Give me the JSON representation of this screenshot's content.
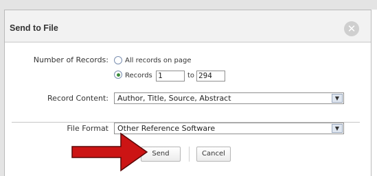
{
  "dialog": {
    "title": "Send to File",
    "close_icon": "close-icon",
    "number_of_records": {
      "label": "Number of Records:",
      "option_all": "All records on page",
      "option_range": "Records",
      "range_from": "1",
      "range_to_label": "to",
      "range_to": "294",
      "selected": "Records"
    },
    "record_content": {
      "label": "Record Content:",
      "value": "Author, Title, Source, Abstract"
    },
    "file_format": {
      "label": "File Format",
      "value": "Other Reference Software"
    },
    "buttons": {
      "send": "Send",
      "cancel": "Cancel"
    },
    "annotation_arrow_color": "#cc1414"
  }
}
